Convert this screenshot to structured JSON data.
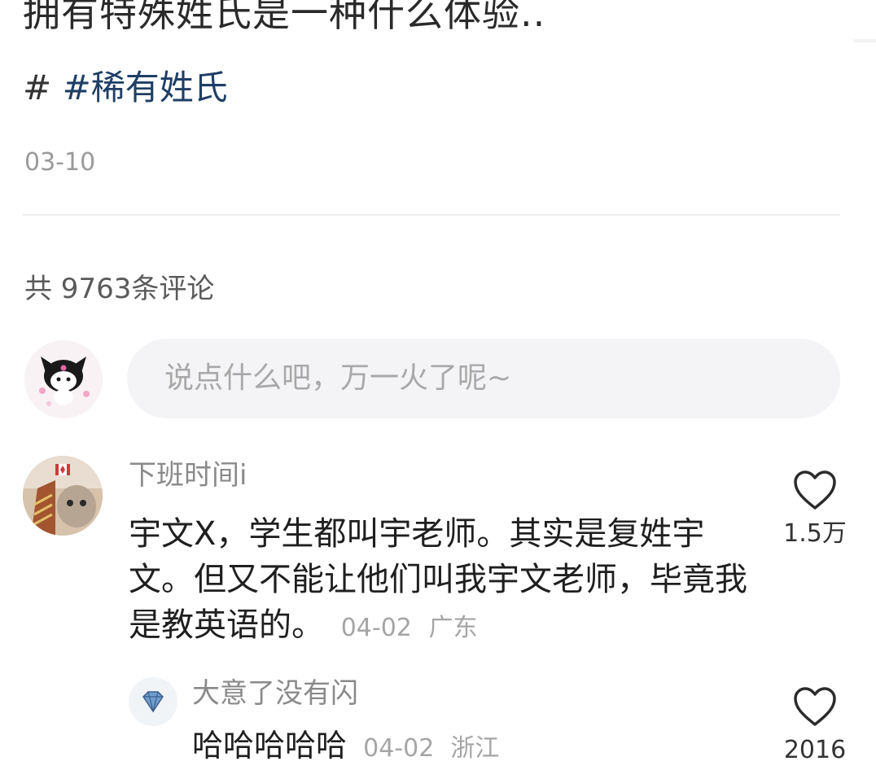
{
  "post": {
    "title": "拥有特殊姓氏是一种什么体验..",
    "hashtag_prefix": "#",
    "hashtag": "#稀有姓氏",
    "date": "03-10"
  },
  "comments_section": {
    "count_label": "共 9763条评论",
    "input_placeholder": "说点什么吧，万一火了呢~"
  },
  "comments": [
    {
      "username": "下班时间i",
      "text": "宇文X，学生都叫宇老师。其实是复姓宇文。但又不能让他们叫我宇文老师，毕竟我是教英语的。",
      "date": "04-02",
      "location": "广东",
      "likes": "1.5万"
    }
  ],
  "replies": [
    {
      "username": "大意了没有闪",
      "text": "哈哈哈哈哈",
      "date": "04-02",
      "location": "浙江",
      "likes": "2016"
    }
  ],
  "colors": {
    "hashtag": "#1f3f66",
    "muted_text": "#9a9a9a",
    "input_bg": "#f4f4f6"
  }
}
